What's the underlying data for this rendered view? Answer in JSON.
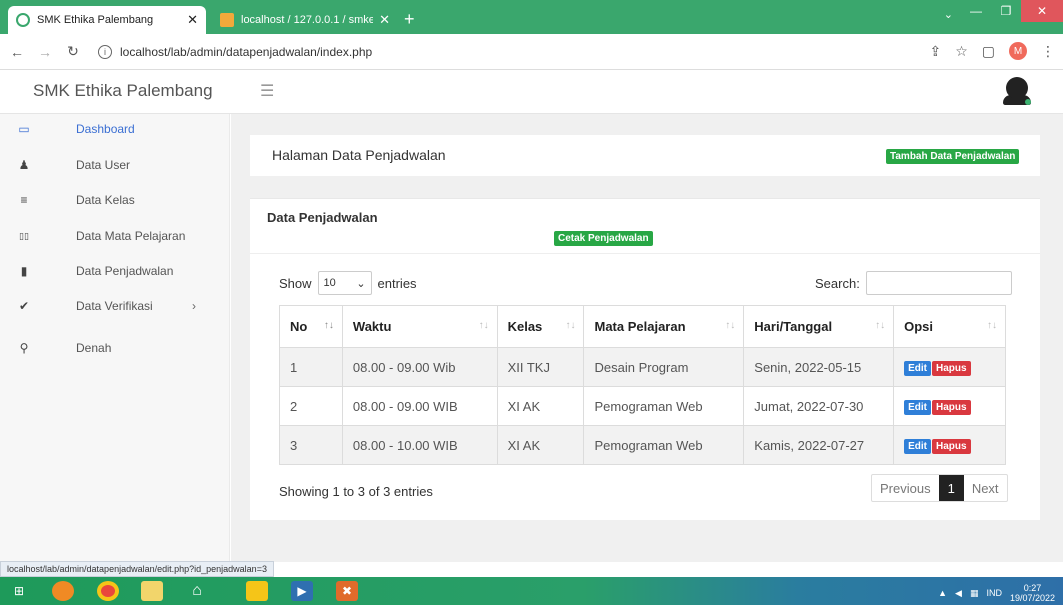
{
  "browser": {
    "tabs": [
      {
        "title": "SMK Ethika Palembang",
        "active": true
      },
      {
        "title": "localhost / 127.0.0.1 / smkethika",
        "active": false
      }
    ],
    "new_tab": "+",
    "url": "localhost/lab/admin/datapenjadwalan/index.php",
    "profile_initial": "M",
    "status_url": "localhost/lab/admin/datapenjadwalan/edit.php?id_penjadwalan=3"
  },
  "app": {
    "brand": "SMK Ethika Palembang",
    "sidebar": [
      {
        "label": "Dashboard",
        "icon": "laptop-icon",
        "glyph": "▭",
        "active": true
      },
      {
        "label": "Data User",
        "icon": "user-icon",
        "glyph": "♟",
        "active": false
      },
      {
        "label": "Data Kelas",
        "icon": "list-icon",
        "glyph": "≡",
        "active": false
      },
      {
        "label": "Data Mata Pelajaran",
        "icon": "book-icon",
        "glyph": "▯▯",
        "active": false
      },
      {
        "label": "Data Penjadwalan",
        "icon": "file-icon",
        "glyph": "▮",
        "active": false
      },
      {
        "label": "Data Verifikasi",
        "icon": "check-icon",
        "glyph": "✔",
        "active": false,
        "has_submenu": true
      },
      {
        "label": "Denah",
        "icon": "map-pin-icon",
        "glyph": "⚲",
        "active": false
      }
    ]
  },
  "page": {
    "title": "Halaman Data Penjadwalan",
    "add_button": "Tambah Data Penjadwalan",
    "card_title": "Data Penjadwalan",
    "print_button": "Cetak Penjadwalan",
    "show_label": "Show",
    "entries_value": "10",
    "entries_label": "entries",
    "search_label": "Search:",
    "search_value": "",
    "showing_text": "Showing 1 to 3 of 3 entries",
    "pager": {
      "previous": "Previous",
      "current": "1",
      "next": "Next"
    }
  },
  "table": {
    "columns": [
      "No",
      "Waktu",
      "Kelas",
      "Mata Pelajaran",
      "Hari/Tanggal",
      "Opsi"
    ],
    "rows": [
      {
        "no": "1",
        "waktu": "08.00 - 09.00 Wib",
        "kelas": "XII TKJ",
        "mapel": "Desain Program",
        "tanggal": "Senin, 2022-05-15"
      },
      {
        "no": "2",
        "waktu": "08.00 - 09.00 WIB",
        "kelas": "XI AK",
        "mapel": "Pemograman Web",
        "tanggal": "Jumat, 2022-07-30"
      },
      {
        "no": "3",
        "waktu": "08.00 - 10.00 WIB",
        "kelas": "XI AK",
        "mapel": "Pemograman Web",
        "tanggal": "Kamis, 2022-07-27"
      }
    ],
    "edit_label": "Edit",
    "delete_label": "Hapus"
  },
  "taskbar": {
    "language": "IND",
    "time": "0:27",
    "date": "19/07/2022"
  },
  "colors": {
    "browser_accent": "#3aa76d",
    "btn_green": "#28a745",
    "btn_edit": "#2f7fd8",
    "btn_delete": "#d9383f",
    "sidebar_active": "#3b6fd3"
  }
}
